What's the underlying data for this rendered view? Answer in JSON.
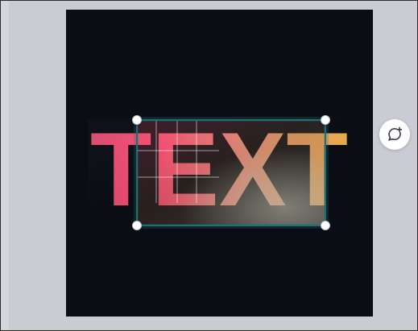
{
  "canvas": {
    "background": "#0a0e14",
    "text_element": {
      "text": "TEXT",
      "gradient_colors": [
        "#ff4f76",
        "#f49a86",
        "#f2b14c"
      ]
    }
  },
  "selection": {
    "border_color": "#1f6e72",
    "handle_color": "#ffffff"
  },
  "comment_button": {
    "icon": "comment-plus-icon"
  },
  "theme": {
    "workspace_background": "#c9ccd3"
  }
}
